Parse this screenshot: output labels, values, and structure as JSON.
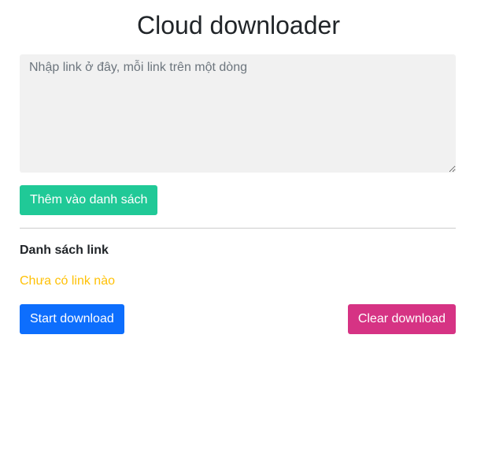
{
  "title": "Cloud downloader",
  "input": {
    "placeholder": "Nhập link ở đây, mỗi link trên một dòng",
    "value": ""
  },
  "add_button": "Thêm vào danh sách",
  "list": {
    "heading": "Danh sách link",
    "empty_text": "Chưa có link nào"
  },
  "start_button": "Start download",
  "clear_button": "Clear download",
  "colors": {
    "add": "#20c997",
    "start": "#0d6efd",
    "clear": "#d63384",
    "empty": "#ffc107"
  }
}
